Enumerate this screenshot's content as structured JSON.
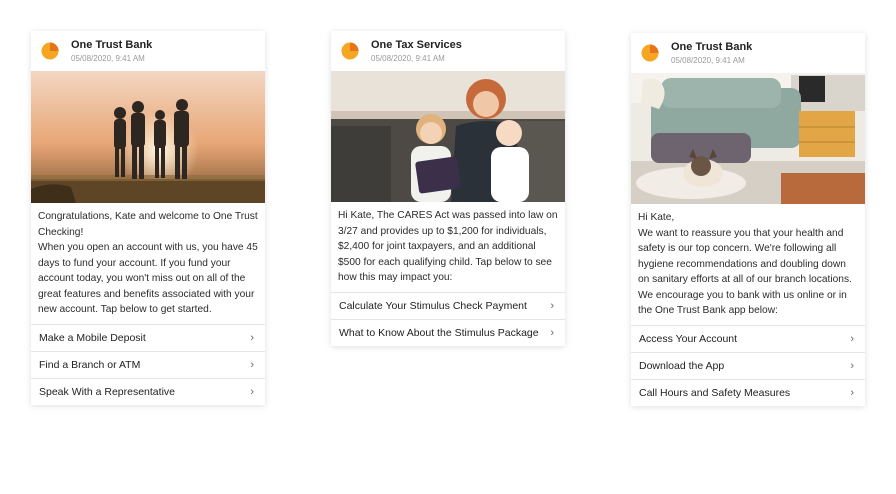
{
  "cards": [
    {
      "sender": "One Trust Bank",
      "timestamp": "05/08/2020, 9:41 AM",
      "body": [
        "Congratulations, Kate and welcome to One Trust Checking!",
        "When you open an account with us, you have 45 days to fund your account. If you fund your account today, you won't miss out on all of the great features and benefits associated with your new account. Tap below to get started."
      ],
      "actions": [
        "Make a Mobile Deposit",
        "Find a Branch or ATM",
        "Speak With a Representative"
      ]
    },
    {
      "sender": "One Tax Services",
      "timestamp": "05/08/2020, 9:41 AM",
      "body": [
        "Hi Kate, The CARES Act was passed into law on 3/27 and provides up to $1,200 for individuals, $2,400 for joint taxpayers, and an additional $500 for each qualifying child. Tap below to see how this may impact you:"
      ],
      "actions": [
        "Calculate Your Stimulus Check Payment",
        "What to Know About the Stimulus Package"
      ]
    },
    {
      "sender": "One Trust Bank",
      "timestamp": "05/08/2020, 9:41 AM",
      "body": [
        "Hi Kate,",
        "We want to reassure you that your health and safety is our top concern. We're following all hygiene recommendations and doubling down on sanitary efforts at all of our branch locations.",
        "We encourage you to bank with us online or in the One Trust Bank app below:"
      ],
      "actions": [
        "Access Your Account",
        "Download the App",
        "Call Hours and Safety Measures"
      ]
    }
  ],
  "icons": {
    "chevron": "›",
    "logo": "orange-circle-logo"
  },
  "colors": {
    "logo_orange": "#F5A623",
    "logo_dark_orange": "#E8741A"
  }
}
